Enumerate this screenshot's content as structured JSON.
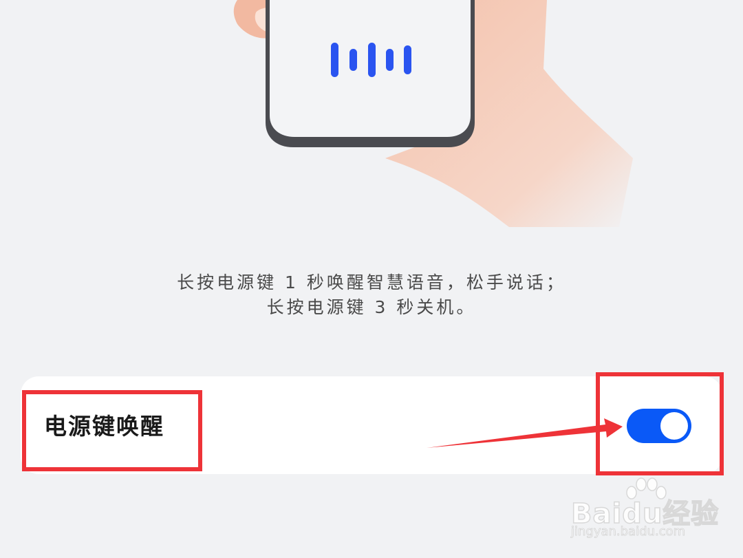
{
  "description": {
    "line1": "长按电源键 1 秒唤醒智慧语音，松手说话；",
    "line2": "长按电源键 3 秒关机。"
  },
  "setting": {
    "label": "电源键唤醒",
    "enabled": true
  },
  "watermark": {
    "brand": "Baidu经验",
    "url": "jingyan.baidu.com"
  },
  "colors": {
    "background": "#f1f2f4",
    "accent": "#0a59f7",
    "annotation": "#ee3338"
  },
  "icons": {
    "illustration": "hand-holding-phone-voice-icon",
    "annotation_arrow": "red-arrow-icon",
    "watermark_logo": "baidu-paw-icon"
  }
}
